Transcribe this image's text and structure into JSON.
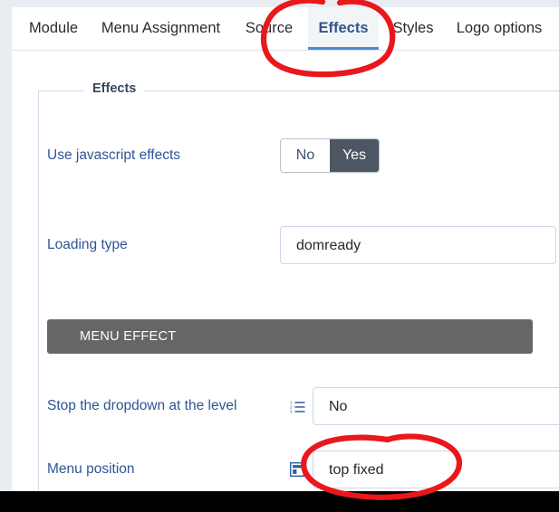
{
  "window": {
    "background_color": "#e9edf2",
    "card_background": "#ffffff",
    "bottom_bar_color": "#000000"
  },
  "tabs": {
    "items": [
      {
        "label": "Module",
        "active": false
      },
      {
        "label": "Menu Assignment",
        "active": false
      },
      {
        "label": "Source",
        "active": false
      },
      {
        "label": "Effects",
        "active": true
      },
      {
        "label": "Styles",
        "active": false
      },
      {
        "label": "Logo options",
        "active": false
      }
    ],
    "active_tab": "Effects",
    "active_underline_color": "#4a8ad4",
    "active_text_color": "#33558b"
  },
  "fieldset": {
    "legend": "Effects"
  },
  "form": {
    "rows": [
      {
        "label": "Use javascript effects",
        "control": "toggle",
        "options": [
          "No",
          "Yes"
        ],
        "value": "Yes"
      },
      {
        "label": "Loading type",
        "control": "text",
        "value": "domready",
        "placeholder": ""
      },
      {
        "label": "Stop the dropdown at the level",
        "control": "text-with-icon",
        "icon": "numbered-list-icon",
        "value": "No",
        "placeholder": ""
      },
      {
        "label": "Menu position",
        "control": "text-with-icon",
        "icon": "layout-top-icon",
        "value": "top fixed",
        "placeholder": ""
      }
    ],
    "label_color": "#2f5596",
    "toggle_selected_color": "#4d5763"
  },
  "section_header": {
    "title": "MENU EFFECT",
    "background_color": "#666666",
    "text_color": "#ffffff"
  },
  "annotations": {
    "color": "#e8181c",
    "marks": [
      {
        "name": "circle-around-effects-tab",
        "target": "Effects"
      },
      {
        "name": "circle-around-menu-position-value",
        "target": "top fixed"
      }
    ]
  }
}
